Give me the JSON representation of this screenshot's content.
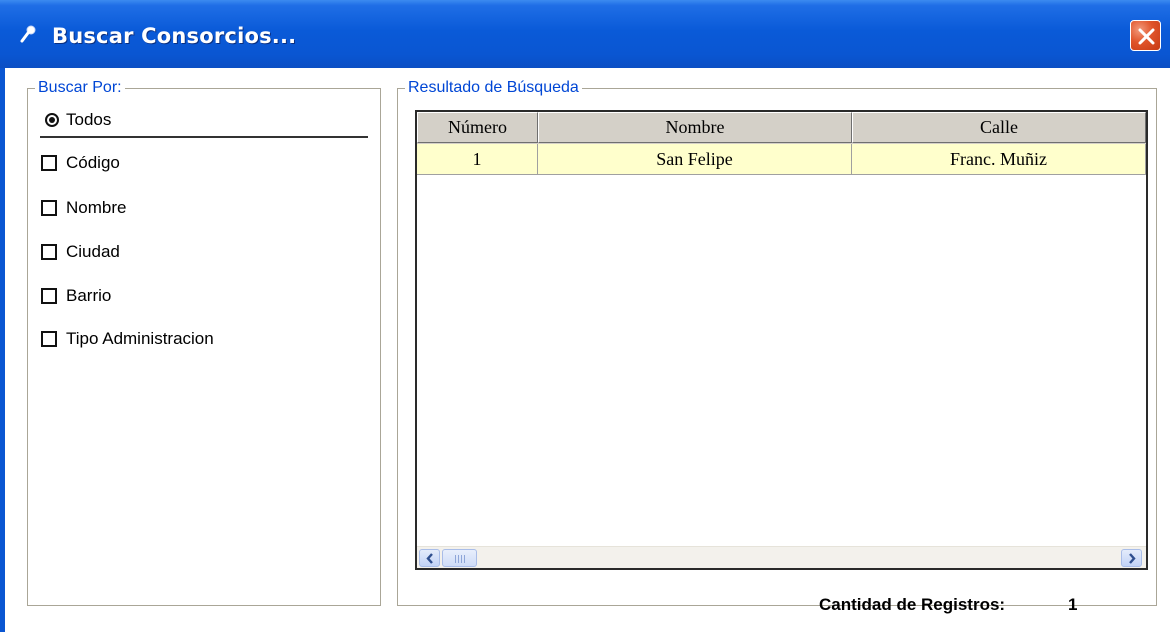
{
  "window": {
    "title": "Buscar Consorcios...",
    "icons": {
      "app": "magnifier-icon",
      "close": "close-icon"
    },
    "colors": {
      "titlebar": "#0a56d2",
      "close": "#e0542a",
      "accent": "#0046d5",
      "row_highlight": "#ffffcc"
    }
  },
  "search_by": {
    "legend": "Buscar Por:",
    "radio_all": {
      "label": "Todos",
      "selected": true
    },
    "options": [
      {
        "label": "Código",
        "checked": false
      },
      {
        "label": "Nombre",
        "checked": false
      },
      {
        "label": "Ciudad",
        "checked": false
      },
      {
        "label": "Barrio",
        "checked": false
      },
      {
        "label": "Tipo Administracion",
        "checked": false
      }
    ]
  },
  "results": {
    "legend": "Resultado de Búsqueda",
    "columns": [
      "Número",
      "Nombre",
      "Calle"
    ],
    "rows": [
      [
        "1",
        "San Felipe",
        "Franc. Muñiz"
      ]
    ],
    "count_label": "Cantidad de Registros:",
    "count_value": "1"
  }
}
